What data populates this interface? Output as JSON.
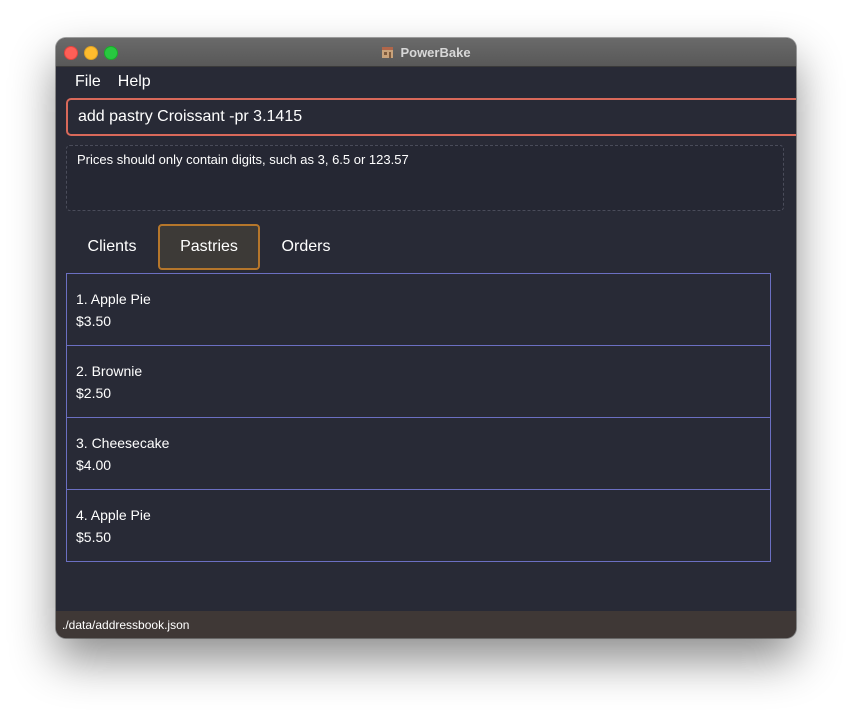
{
  "window": {
    "title": "PowerBake",
    "app_icon": "bakery-icon"
  },
  "menu": {
    "items": [
      {
        "label": "File"
      },
      {
        "label": "Help"
      }
    ]
  },
  "command": {
    "value": "add pastry Croissant -pr 3.1415"
  },
  "result": {
    "message": "Prices should only contain digits, such as 3, 6.5 or 123.57"
  },
  "tabs": [
    {
      "label": "Clients",
      "selected": false
    },
    {
      "label": "Pastries",
      "selected": true
    },
    {
      "label": "Orders",
      "selected": false
    }
  ],
  "pastries": [
    {
      "name": "1. Apple Pie",
      "price": "$3.50"
    },
    {
      "name": "2. Brownie",
      "price": "$2.50"
    },
    {
      "name": "3. Cheesecake",
      "price": "$4.00"
    },
    {
      "name": "4. Apple  Pie",
      "price": "$5.50"
    }
  ],
  "status": {
    "path": "./data/addressbook.json"
  },
  "colors": {
    "background": "#282a36",
    "command_border": "#d9695a",
    "tab_selected_border": "#b5762b",
    "list_border": "#6b6fc2",
    "status_bar": "#3f3836"
  }
}
